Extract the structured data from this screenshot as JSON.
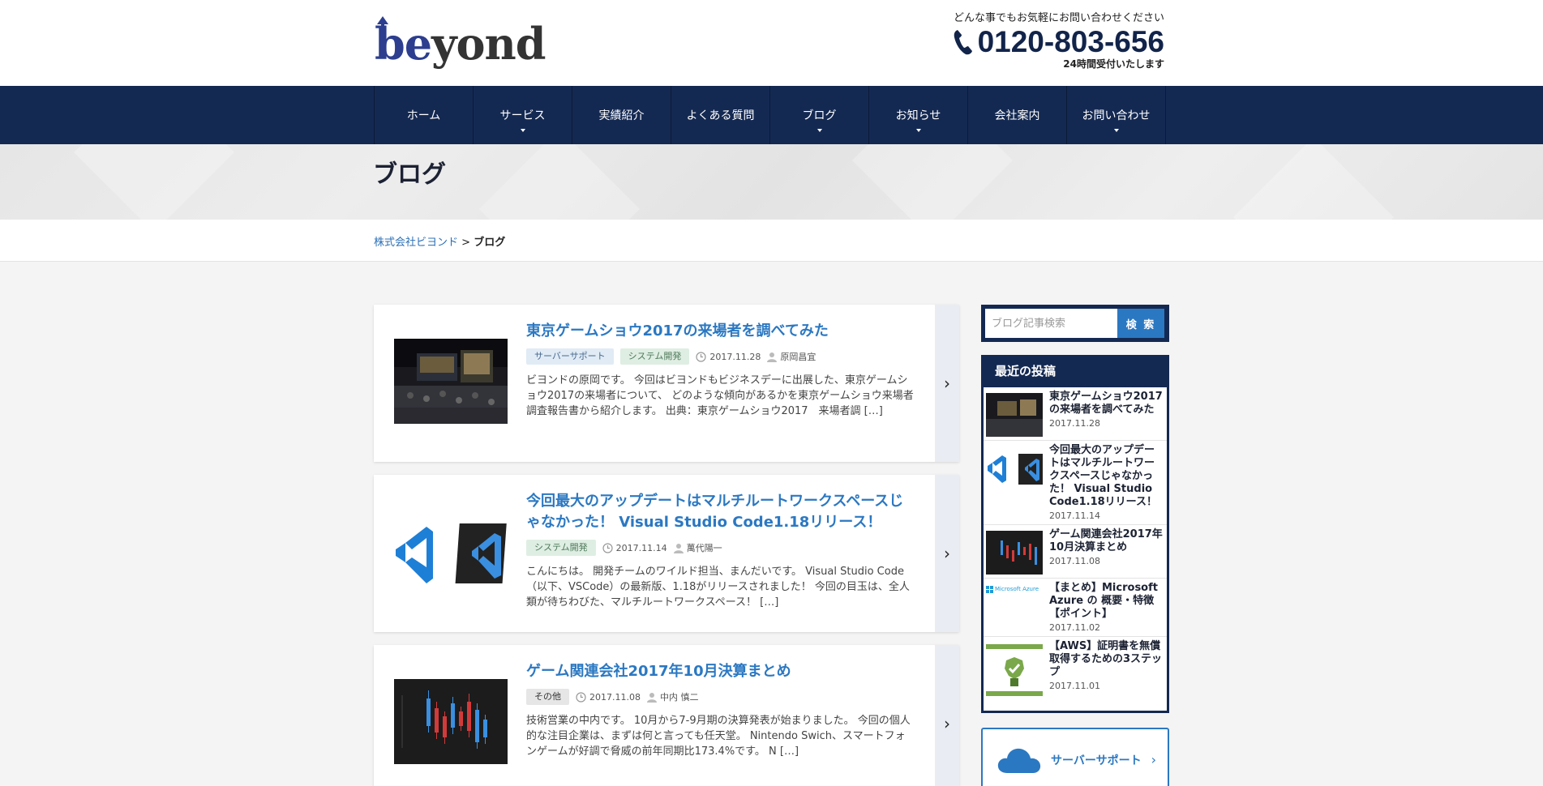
{
  "header": {
    "logo_text_be": "be",
    "logo_text_rest": "yond",
    "contact_note": "どんな事でもお気軽にお問い合わせください",
    "phone": "0120-803-656",
    "hours": "24時間受付いたします"
  },
  "nav": {
    "items": [
      {
        "label": "ホーム",
        "has_dropdown": false
      },
      {
        "label": "サービス",
        "has_dropdown": true
      },
      {
        "label": "実績紹介",
        "has_dropdown": false
      },
      {
        "label": "よくある質問",
        "has_dropdown": false
      },
      {
        "label": "ブログ",
        "has_dropdown": true
      },
      {
        "label": "お知らせ",
        "has_dropdown": true
      },
      {
        "label": "会社案内",
        "has_dropdown": false
      },
      {
        "label": "お問い合わせ",
        "has_dropdown": true
      }
    ]
  },
  "page": {
    "title": "ブログ"
  },
  "breadcrumb": {
    "home": "株式会社ビヨンド",
    "separator": ">",
    "current": "ブログ"
  },
  "posts": [
    {
      "title": "東京ゲームショウ2017の来場者を調べてみた",
      "tags": [
        {
          "label": "サーバーサポート",
          "style": "blue"
        },
        {
          "label": "システム開発",
          "style": "green"
        }
      ],
      "date": "2017.11.28",
      "author": "原岡昌宜",
      "excerpt": "ビヨンドの原岡です。 今回はビヨンドもビジネスデーに出展した、東京ゲームショウ2017の来場者について、 どのような傾向があるかを東京ゲームショウ来場者調査報告書から紹介します。 出典：東京ゲームショウ2017　来場者調 […]"
    },
    {
      "title": "今回最大のアップデートはマルチルートワークスペースじゃなかった！ Visual Studio Code1.18リリース！",
      "tags": [
        {
          "label": "システム開発",
          "style": "green"
        }
      ],
      "date": "2017.11.14",
      "author": "萬代陽一",
      "excerpt": "こんにちは。 開発チームのワイルド担当、まんだいです。 Visual Studio Code（以下、VSCode）の最新版、1.18がリリースされました！ 今回の目玉は、全人類が待ちわびた、マルチルートワークスペース！ […]"
    },
    {
      "title": "ゲーム関連会社2017年10月決算まとめ",
      "tags": [
        {
          "label": "その他",
          "style": "gray"
        }
      ],
      "date": "2017.11.08",
      "author": "中内 慎二",
      "excerpt": "技術営業の中内です。 10月から7-9月期の決算発表が始まりました。 今回の個人的な注目企業は、まずは何と言っても任天堂。 Nintendo Swich、スマートフォンゲームが好調で脅威の前年同期比173.4%です。 N […]"
    }
  ],
  "sidebar": {
    "search_placeholder": "ブログ記事検索",
    "search_button": "検 索",
    "recent_heading": "最近の投稿",
    "recent": [
      {
        "title": "東京ゲームショウ2017の来場者を調べてみた",
        "date": "2017.11.28"
      },
      {
        "title": "今回最大のアップデートはマルチルートワークスペースじゃなかった！ Visual Studio Code1.18リリース！",
        "date": "2017.11.14"
      },
      {
        "title": "ゲーム関連会社2017年10月決算まとめ",
        "date": "2017.11.08"
      },
      {
        "title": "【まとめ】Microsoft Azure の 概要・特徴【ポイント】",
        "date": "2017.11.02",
        "thumb_text": "Microsoft Azure"
      },
      {
        "title": "【AWS】証明書を無償取得するための3ステップ",
        "date": "2017.11.01"
      }
    ],
    "category_label": "サーバーサポート"
  },
  "colors": {
    "navy": "#142952",
    "link_blue": "#2b78c2"
  }
}
